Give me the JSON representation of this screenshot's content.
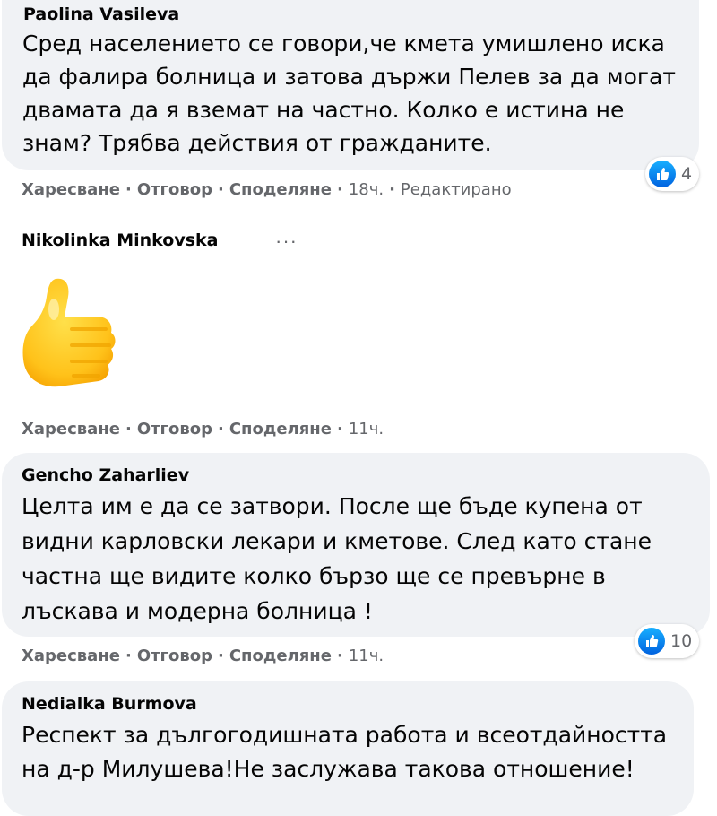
{
  "actions": {
    "like": "Харесване",
    "reply": "Отговор",
    "share": "Споделяне",
    "separator": "·"
  },
  "comments": [
    {
      "author": "Paolina Vasileva",
      "lines": [
        "Сред населението се говори,че кмета умишлено иска",
        "да фалира болница и затова държи Пелев за да могат",
        "двамата да я вземат на частно. Колко е истина не",
        "знам? Трябва действия от гражданите."
      ],
      "time": "18ч.",
      "edited": "Редактирано",
      "reactions": "4"
    },
    {
      "author": "Nikolinka Minkovska",
      "sticker": "thumbs-up-sticker",
      "more": "···",
      "time": "11ч."
    },
    {
      "author": "Gencho Zaharliev",
      "lines": [
        "Целта им е да се затвори. После ще бъде купена от",
        "видни карловски лекари и кметове. След като стане",
        "частна ще видите колко бързо ще се превърне в",
        "лъскава и модерна болница !"
      ],
      "time": "11ч.",
      "reactions": "10"
    },
    {
      "author": "Nedialka Burmova",
      "lines": [
        "Респект за дългогодишната работа и всеотдайността",
        "на д-р Милушева!Не заслужава такова отношение!"
      ]
    }
  ],
  "colors": {
    "bubble": "#f0f2f5",
    "meta": "#65676b",
    "like_blue": "#1877f2",
    "sticker": "#ffc21a"
  }
}
